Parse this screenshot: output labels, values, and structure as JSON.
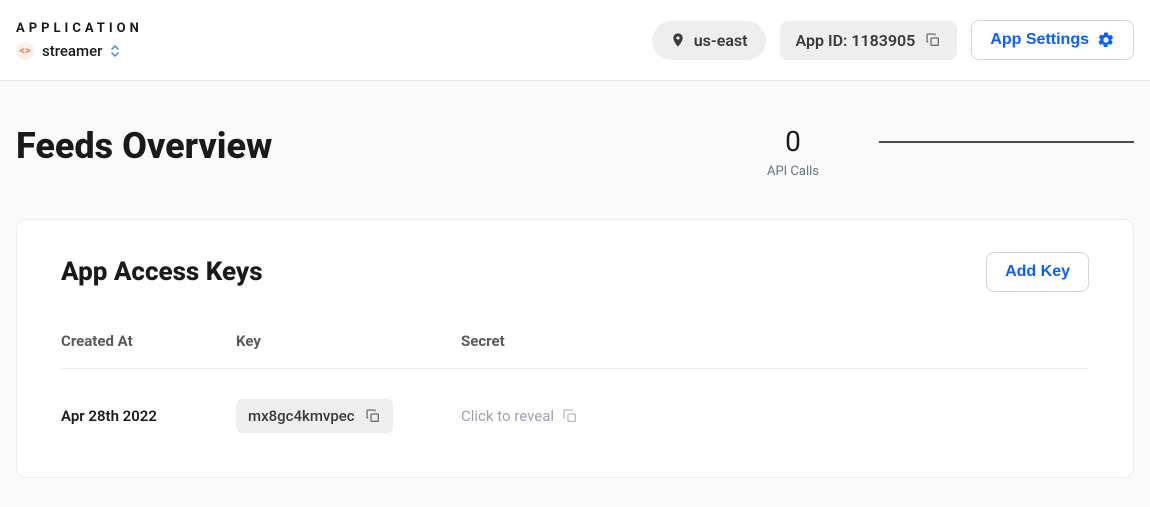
{
  "header": {
    "app_label": "APPLICATION",
    "app_name": "streamer",
    "region": "us-east",
    "app_id_label": "App ID: 1183905",
    "settings_label": "App Settings"
  },
  "page": {
    "title": "Feeds Overview"
  },
  "stats": {
    "api_calls_value": "0",
    "api_calls_label": "API Calls"
  },
  "keys": {
    "card_title": "App Access Keys",
    "add_button": "Add Key",
    "columns": {
      "created": "Created At",
      "key": "Key",
      "secret": "Secret"
    },
    "rows": [
      {
        "created": "Apr 28th 2022",
        "key": "mx8gc4kmvpec",
        "secret_reveal": "Click to reveal"
      }
    ]
  }
}
